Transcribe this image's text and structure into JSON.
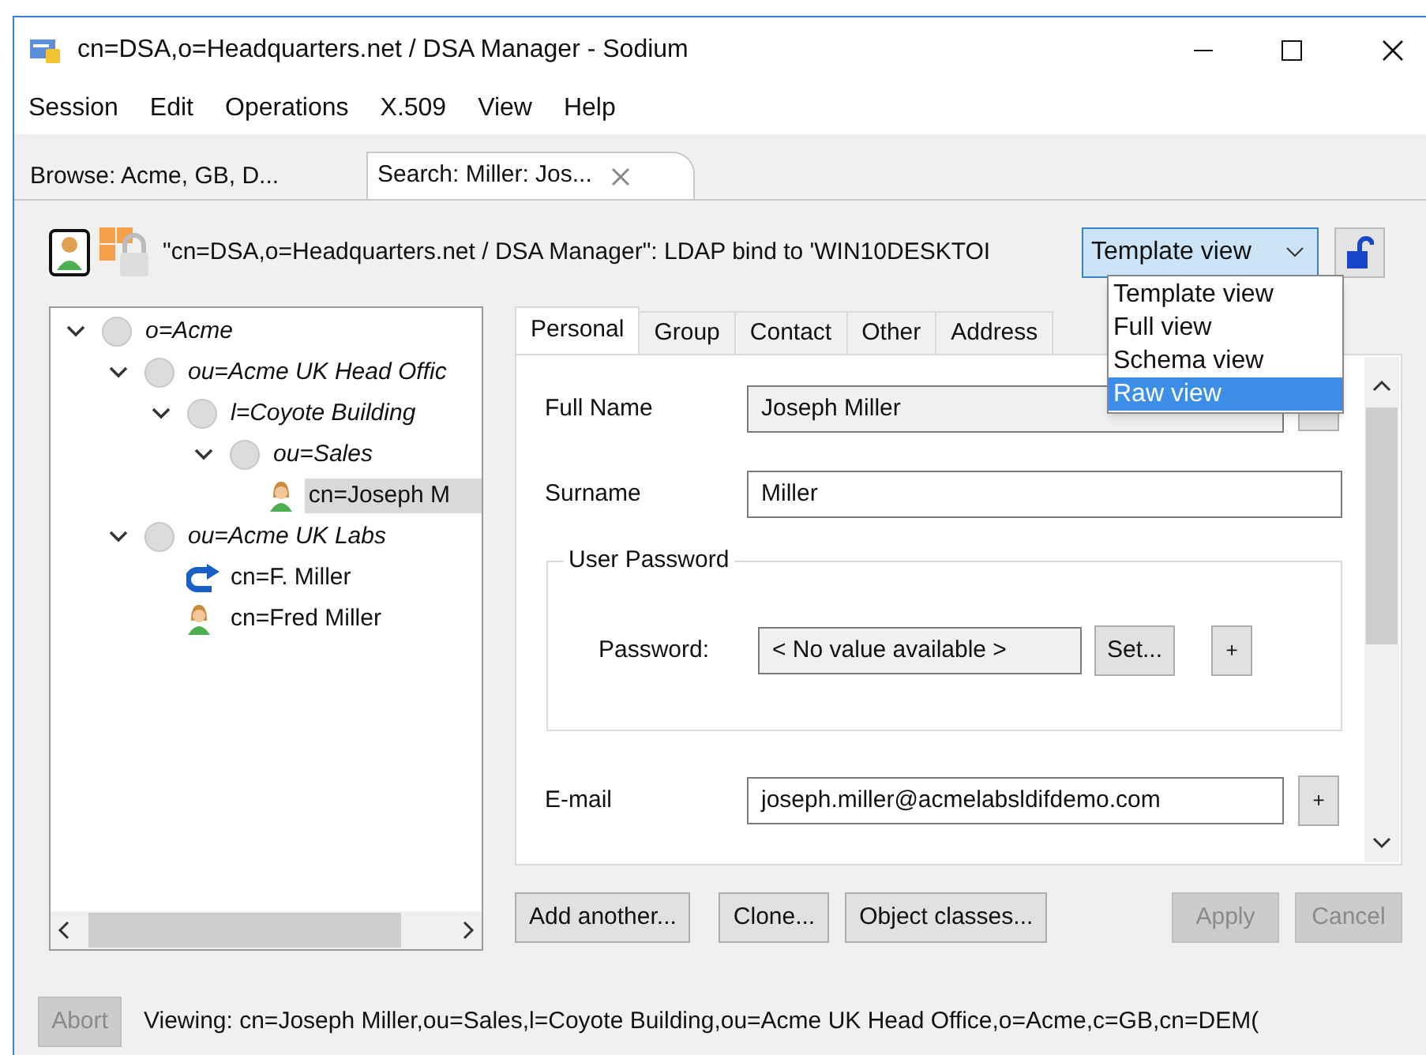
{
  "window": {
    "title": "cn=DSA,o=Headquarters.net / DSA Manager - Sodium"
  },
  "menu": [
    "Session",
    "Edit",
    "Operations",
    "X.509",
    "View",
    "Help"
  ],
  "tabs": [
    {
      "label": "Browse: Acme, GB, D...",
      "selected": false,
      "closable": false
    },
    {
      "label": "Search: Miller: Jos...",
      "selected": true,
      "closable": true
    }
  ],
  "toolbar": {
    "bind_text": "\"cn=DSA,o=Headquarters.net / DSA Manager\": LDAP bind to 'WIN10DESKTOI",
    "view_select": {
      "value": "Template view",
      "expanded": true,
      "options": [
        {
          "label": "Template view",
          "highlighted": false
        },
        {
          "label": "Full view",
          "highlighted": false
        },
        {
          "label": "Schema view",
          "highlighted": false
        },
        {
          "label": "Raw view",
          "highlighted": true
        }
      ]
    }
  },
  "tree": [
    {
      "label": "o=Acme",
      "kind": "container",
      "expanded": true,
      "selected": false,
      "children": [
        {
          "label": "ou=Acme UK Head Offic",
          "kind": "container",
          "expanded": true,
          "selected": false,
          "children": [
            {
              "label": "l=Coyote Building",
              "kind": "container",
              "expanded": true,
              "selected": false,
              "children": [
                {
                  "label": "ou=Sales",
                  "kind": "container",
                  "expanded": true,
                  "selected": false,
                  "children": [
                    {
                      "label": "cn=Joseph M",
                      "kind": "person",
                      "selected": true
                    }
                  ]
                }
              ]
            }
          ]
        },
        {
          "label": "ou=Acme UK Labs",
          "kind": "container",
          "expanded": true,
          "selected": false,
          "children": [
            {
              "label": "cn=F. Miller",
              "kind": "alias",
              "selected": false
            },
            {
              "label": "cn=Fred Miller",
              "kind": "person",
              "selected": false
            }
          ]
        }
      ]
    }
  ],
  "detail_tabs": [
    {
      "label": "Personal",
      "selected": true
    },
    {
      "label": "Group",
      "selected": false
    },
    {
      "label": "Contact",
      "selected": false
    },
    {
      "label": "Other",
      "selected": false
    },
    {
      "label": "Address",
      "selected": false
    }
  ],
  "form": {
    "full_name": {
      "label": "Full Name",
      "value": "Joseph Miller"
    },
    "surname": {
      "label": "Surname",
      "value": "Miller"
    },
    "user_password": {
      "legend": "User Password",
      "label": "Password:",
      "value": "< No value available >",
      "set_button": "Set...",
      "add_button": "+"
    },
    "email": {
      "label": "E-mail",
      "value": "joseph.miller@acmelabsldifdemo.com",
      "add_button": "+"
    }
  },
  "buttons": [
    {
      "label": "Add another...",
      "disabled": false
    },
    {
      "label": "Clone...",
      "disabled": false
    },
    {
      "label": "Object classes...",
      "disabled": false
    },
    {
      "label": "Apply",
      "disabled": true
    },
    {
      "label": "Cancel",
      "disabled": true
    }
  ],
  "status": {
    "abort": {
      "label": "Abort",
      "disabled": true
    },
    "text": "Viewing: cn=Joseph Miller,ou=Sales,l=Coyote Building,ou=Acme UK Head Office,o=Acme,c=GB,cn=DEM("
  }
}
